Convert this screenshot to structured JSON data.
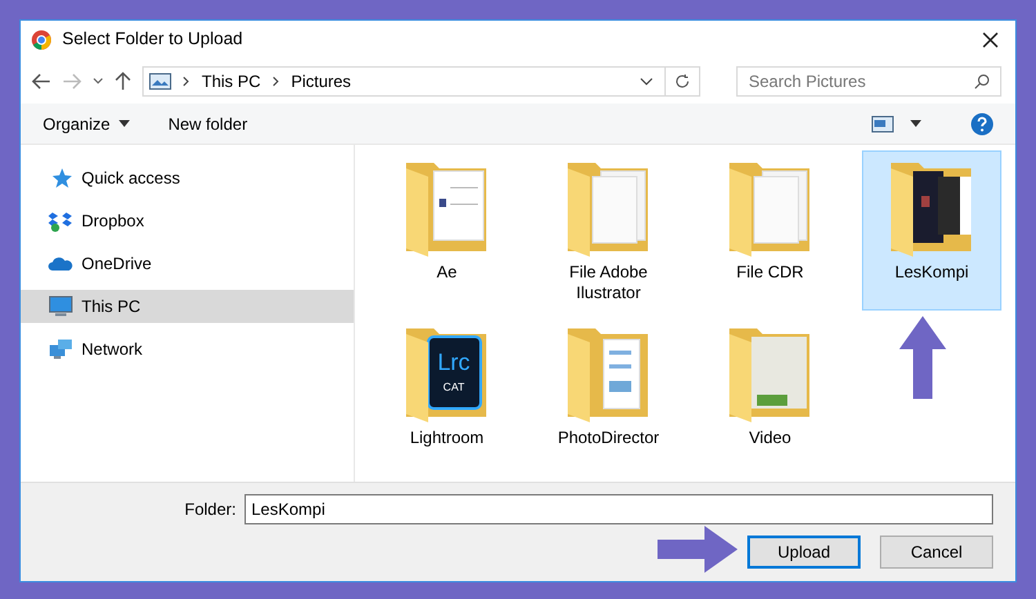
{
  "window": {
    "title": "Select Folder to Upload"
  },
  "address": {
    "crumbs": [
      "This PC",
      "Pictures"
    ],
    "search_placeholder": "Search Pictures"
  },
  "toolbar": {
    "organize": "Organize",
    "new_folder": "New folder"
  },
  "sidebar": {
    "items": [
      {
        "label": "Quick access",
        "kind": "star",
        "selected": false
      },
      {
        "label": "Dropbox",
        "kind": "dropbox",
        "selected": false
      },
      {
        "label": "OneDrive",
        "kind": "cloud",
        "selected": false
      },
      {
        "label": "This PC",
        "kind": "pc",
        "selected": true
      },
      {
        "label": "Network",
        "kind": "network",
        "selected": false
      }
    ]
  },
  "folders": [
    {
      "name": "Ae",
      "kind": "docs",
      "selected": false
    },
    {
      "name": "File Adobe Ilustrator",
      "kind": "pages",
      "selected": false
    },
    {
      "name": "File CDR",
      "kind": "pages",
      "selected": false
    },
    {
      "name": "LesKompi",
      "kind": "photo",
      "selected": true
    },
    {
      "name": "Lightroom",
      "kind": "badge",
      "badge_title": "Lrc",
      "badge_subtitle": "CAT",
      "selected": false
    },
    {
      "name": "PhotoDirector",
      "kind": "sheets",
      "selected": false
    },
    {
      "name": "Video",
      "kind": "room",
      "selected": false
    }
  ],
  "footer": {
    "folder_label": "Folder:",
    "folder_value": "LesKompi",
    "buttons": [
      {
        "label": "Upload",
        "selected": true
      },
      {
        "label": "Cancel",
        "selected": false
      }
    ]
  }
}
